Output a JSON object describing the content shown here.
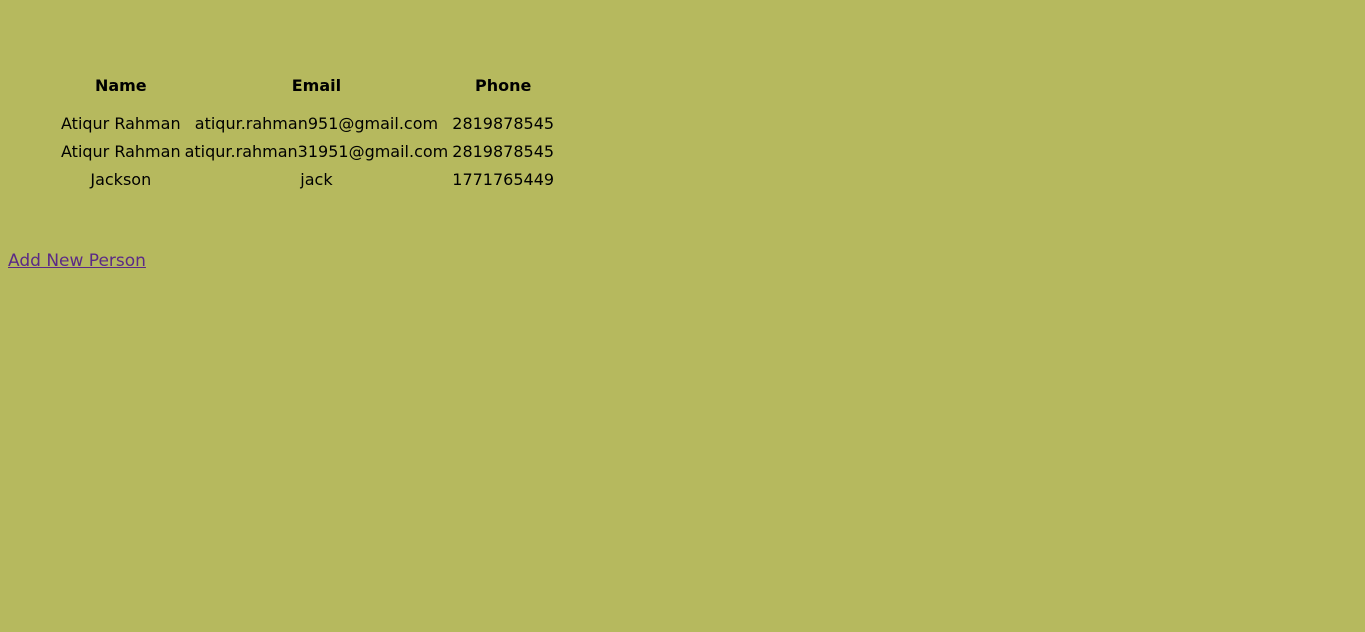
{
  "table": {
    "headers": [
      "Name",
      "Email",
      "Phone"
    ],
    "rows": [
      [
        "Atiqur Rahman",
        "atiqur.rahman951@gmail.com",
        "2819878545"
      ],
      [
        "Atiqur Rahman",
        "atiqur.rahman31951@gmail.com",
        "2819878545"
      ],
      [
        "Jackson",
        "jack",
        "1771765449"
      ]
    ]
  },
  "links": {
    "add_new_person": "Add New Person"
  },
  "colors": {
    "background": "#b6b95e",
    "link": "#5b2a86"
  }
}
